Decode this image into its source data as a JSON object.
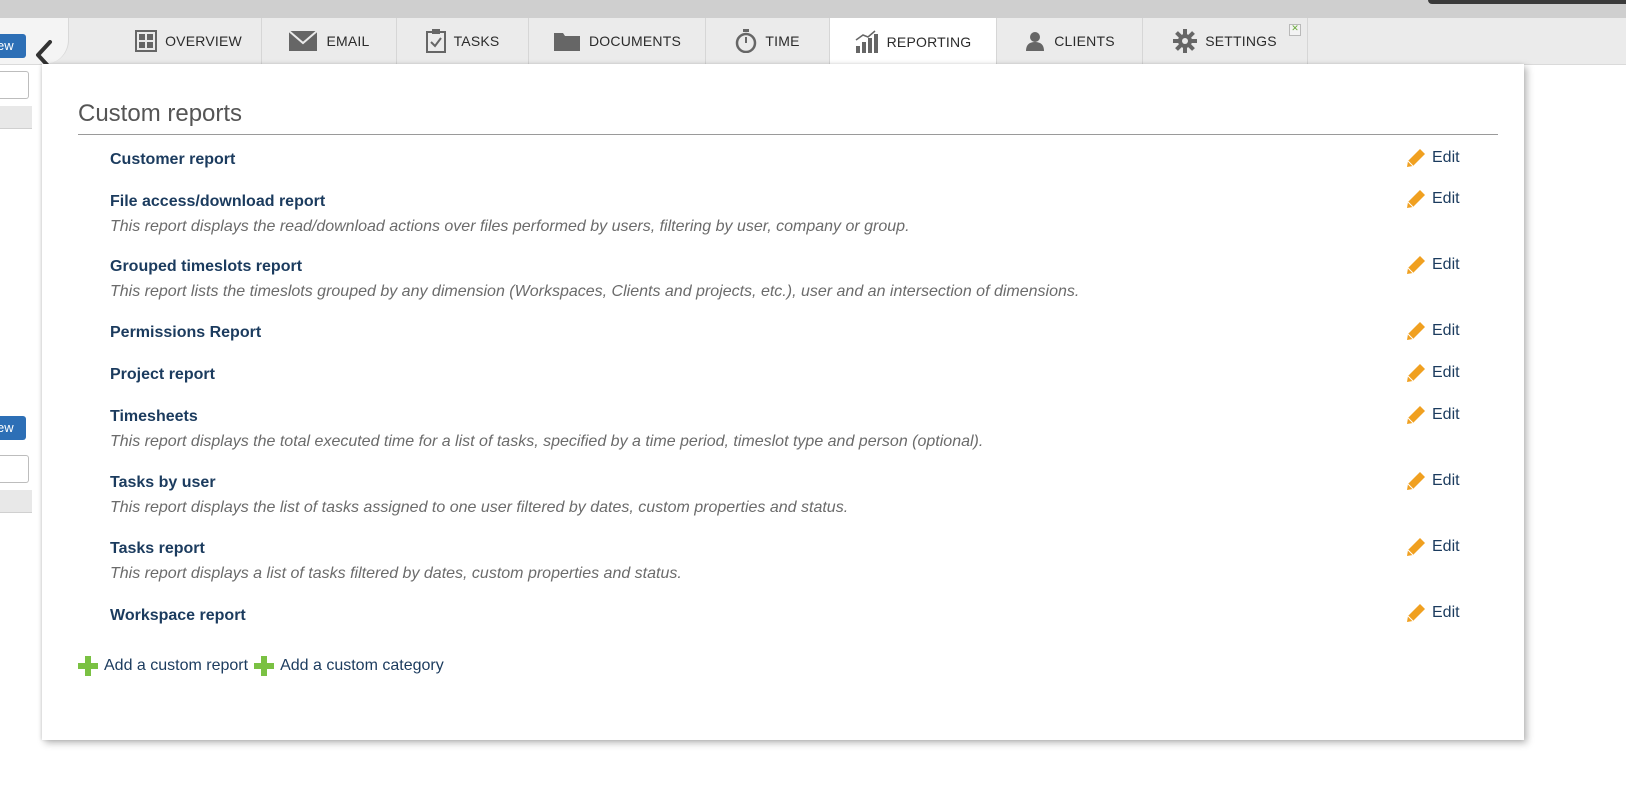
{
  "tabs": [
    {
      "label": "OVERVIEW",
      "icon": "overview-icon",
      "active": false
    },
    {
      "label": "EMAIL",
      "icon": "email-icon",
      "active": false
    },
    {
      "label": "TASKS",
      "icon": "tasks-icon",
      "active": false
    },
    {
      "label": "DOCUMENTS",
      "icon": "documents-icon",
      "active": false
    },
    {
      "label": "TIME",
      "icon": "time-icon",
      "active": false
    },
    {
      "label": "REPORTING",
      "icon": "reporting-icon",
      "active": true
    },
    {
      "label": "CLIENTS",
      "icon": "clients-icon",
      "active": false
    },
    {
      "label": "SETTINGS",
      "icon": "settings-icon",
      "active": false
    }
  ],
  "left": {
    "new_button_label": "ew",
    "new_button_label_2": "ew"
  },
  "section_title": "Custom reports",
  "reports": [
    {
      "name": "Customer report",
      "description": ""
    },
    {
      "name": "File access/download report",
      "description": "This report displays the read/download actions over files performed by users, filtering by user, company or group."
    },
    {
      "name": "Grouped timeslots report",
      "description": "This report lists the timeslots grouped by any dimension (Workspaces, Clients and projects, etc.), user and an intersection of dimensions."
    },
    {
      "name": "Permissions Report",
      "description": ""
    },
    {
      "name": "Project report",
      "description": ""
    },
    {
      "name": "Timesheets",
      "description": "This report displays the total executed time for a list of tasks, specified by a time period, timeslot type and person (optional)."
    },
    {
      "name": "Tasks by user",
      "description": "This report displays the list of tasks assigned to one user filtered by dates, custom properties and status."
    },
    {
      "name": "Tasks report",
      "description": "This report displays a list of tasks filtered by dates, custom properties and status."
    },
    {
      "name": "Workspace report",
      "description": ""
    }
  ],
  "edit_label": "Edit",
  "actions": {
    "add_report": "Add a custom report",
    "add_category": "Add a custom category"
  },
  "colors": {
    "link": "#1b3b5e",
    "edit_icon": "#f0a020",
    "add_icon": "#7ac143",
    "active_tab": "#ffffff",
    "tab_bar": "#ebebeb"
  }
}
